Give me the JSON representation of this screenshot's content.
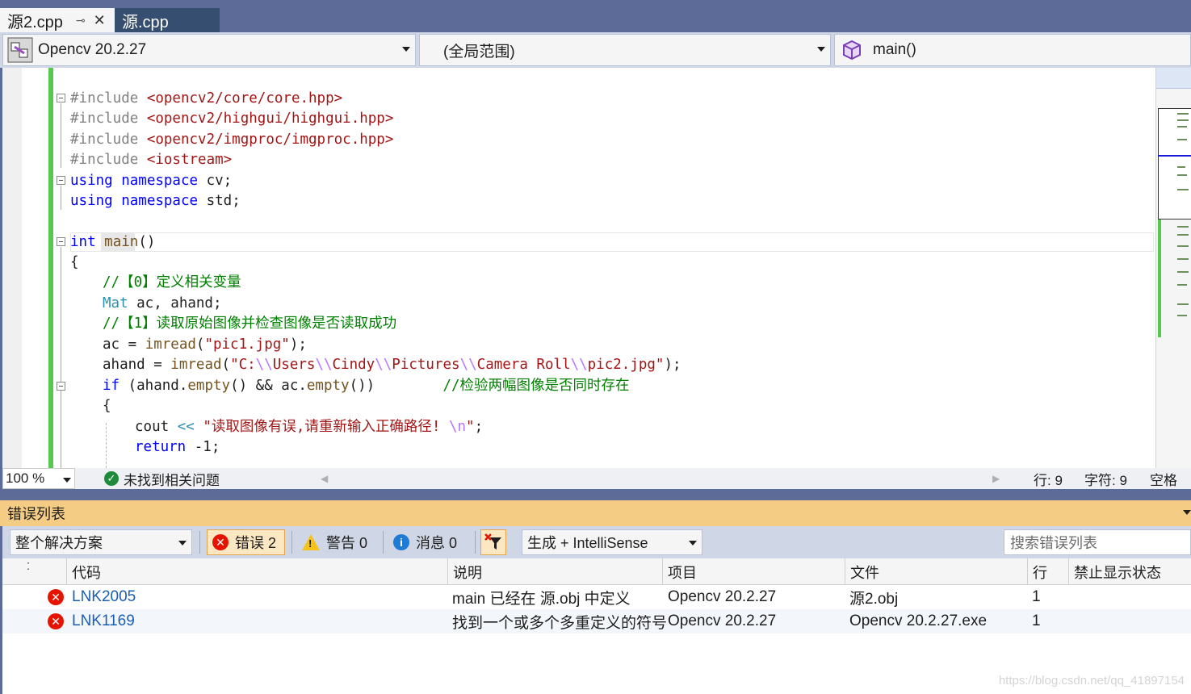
{
  "tabs": [
    {
      "label": "源2.cpp",
      "pin": "⊸",
      "close": "✕"
    },
    {
      "label": "源.cpp"
    }
  ],
  "navbar": {
    "project": "Opencv 20.2.27",
    "scope": "(全局范围)",
    "function": "main()"
  },
  "code": {
    "l1": {
      "pp": "#include ",
      "inc": "<opencv2/core/core.hpp>"
    },
    "l2": {
      "pp": "#include ",
      "inc": "<opencv2/highgui/highgui.hpp>"
    },
    "l3": {
      "pp": "#include ",
      "inc": "<opencv2/imgproc/imgproc.hpp>"
    },
    "l4": {
      "pp": "#include ",
      "inc": "<iostream>"
    },
    "l5": {
      "kw": "using namespace",
      "rest": " cv;"
    },
    "l6": {
      "kw": "using namespace",
      "rest": " std;"
    },
    "l8": {
      "kw": "int",
      "sp": " ",
      "fn": "main",
      "rest": "()"
    },
    "l9": "{",
    "l10": "//【0】定义相关变量",
    "l11": {
      "ty": "Mat",
      "rest": " ac, ahand;"
    },
    "l12": "//【1】读取原始图像并检查图像是否读取成功",
    "l13": {
      "a": "ac = ",
      "fn": "imread",
      "b": "(",
      "str": "\"pic1.jpg\"",
      "c": ");"
    },
    "l14": {
      "a": "ahand = ",
      "fn": "imread",
      "b": "(",
      "s1": "\"C:",
      "e1": "\\\\",
      "s2": "Users",
      "e2": "\\\\",
      "s3": "Cindy",
      "e3": "\\\\",
      "s4": "Pictures",
      "e4": "\\\\",
      "s5": "Camera Roll",
      "e5": "\\\\",
      "s6": "pic2.jpg\"",
      "c": ");"
    },
    "l15": {
      "kw": "if",
      "a": " (ahand.",
      "fn1": "empty",
      "b": "() && ac.",
      "fn2": "empty",
      "c": "())",
      "pad": "        ",
      "cm": "//检验两幅图像是否同时存在"
    },
    "l16": "{",
    "l17": {
      "a": "cout ",
      "op": "<<",
      "sp": " ",
      "str": "\"读取图像有误,请重新输入正确路径! ",
      "esc": "\\n",
      "str2": "\"",
      "c": ";"
    },
    "l18": {
      "kw": "return",
      "rest": " -1;"
    }
  },
  "statusbar": {
    "zoom": "100 %",
    "issues": "未找到相关问题",
    "line": "行: 9",
    "char": "字符: 9",
    "mode": "空格"
  },
  "error_list": {
    "title": "错误列表",
    "scope": "整个解决方案",
    "errors_label": "错误 2",
    "warnings_label": "警告 0",
    "messages_label": "消息 0",
    "build_filter": "生成 + IntelliSense",
    "search_placeholder": "搜索错误列表",
    "columns": [
      "代码",
      "说明",
      "项目",
      "文件",
      "行",
      "禁止显示状态"
    ],
    "rows": [
      {
        "code": "LNK2005",
        "desc": "main 已经在 源.obj 中定义",
        "project": "Opencv 20.2.27",
        "file": "源2.obj",
        "line": "1"
      },
      {
        "code": "LNK1169",
        "desc": "找到一个或多个多重定义的符号",
        "project": "Opencv 20.2.27",
        "file": "Opencv 20.2.27.exe",
        "line": "1"
      }
    ]
  },
  "watermark": "https://blog.csdn.net/qq_41897154",
  "colors": {
    "frame": "#5d6b99",
    "panel_title": "#f5cc84",
    "error": "#e51400",
    "change_bar": "#57c84d"
  }
}
